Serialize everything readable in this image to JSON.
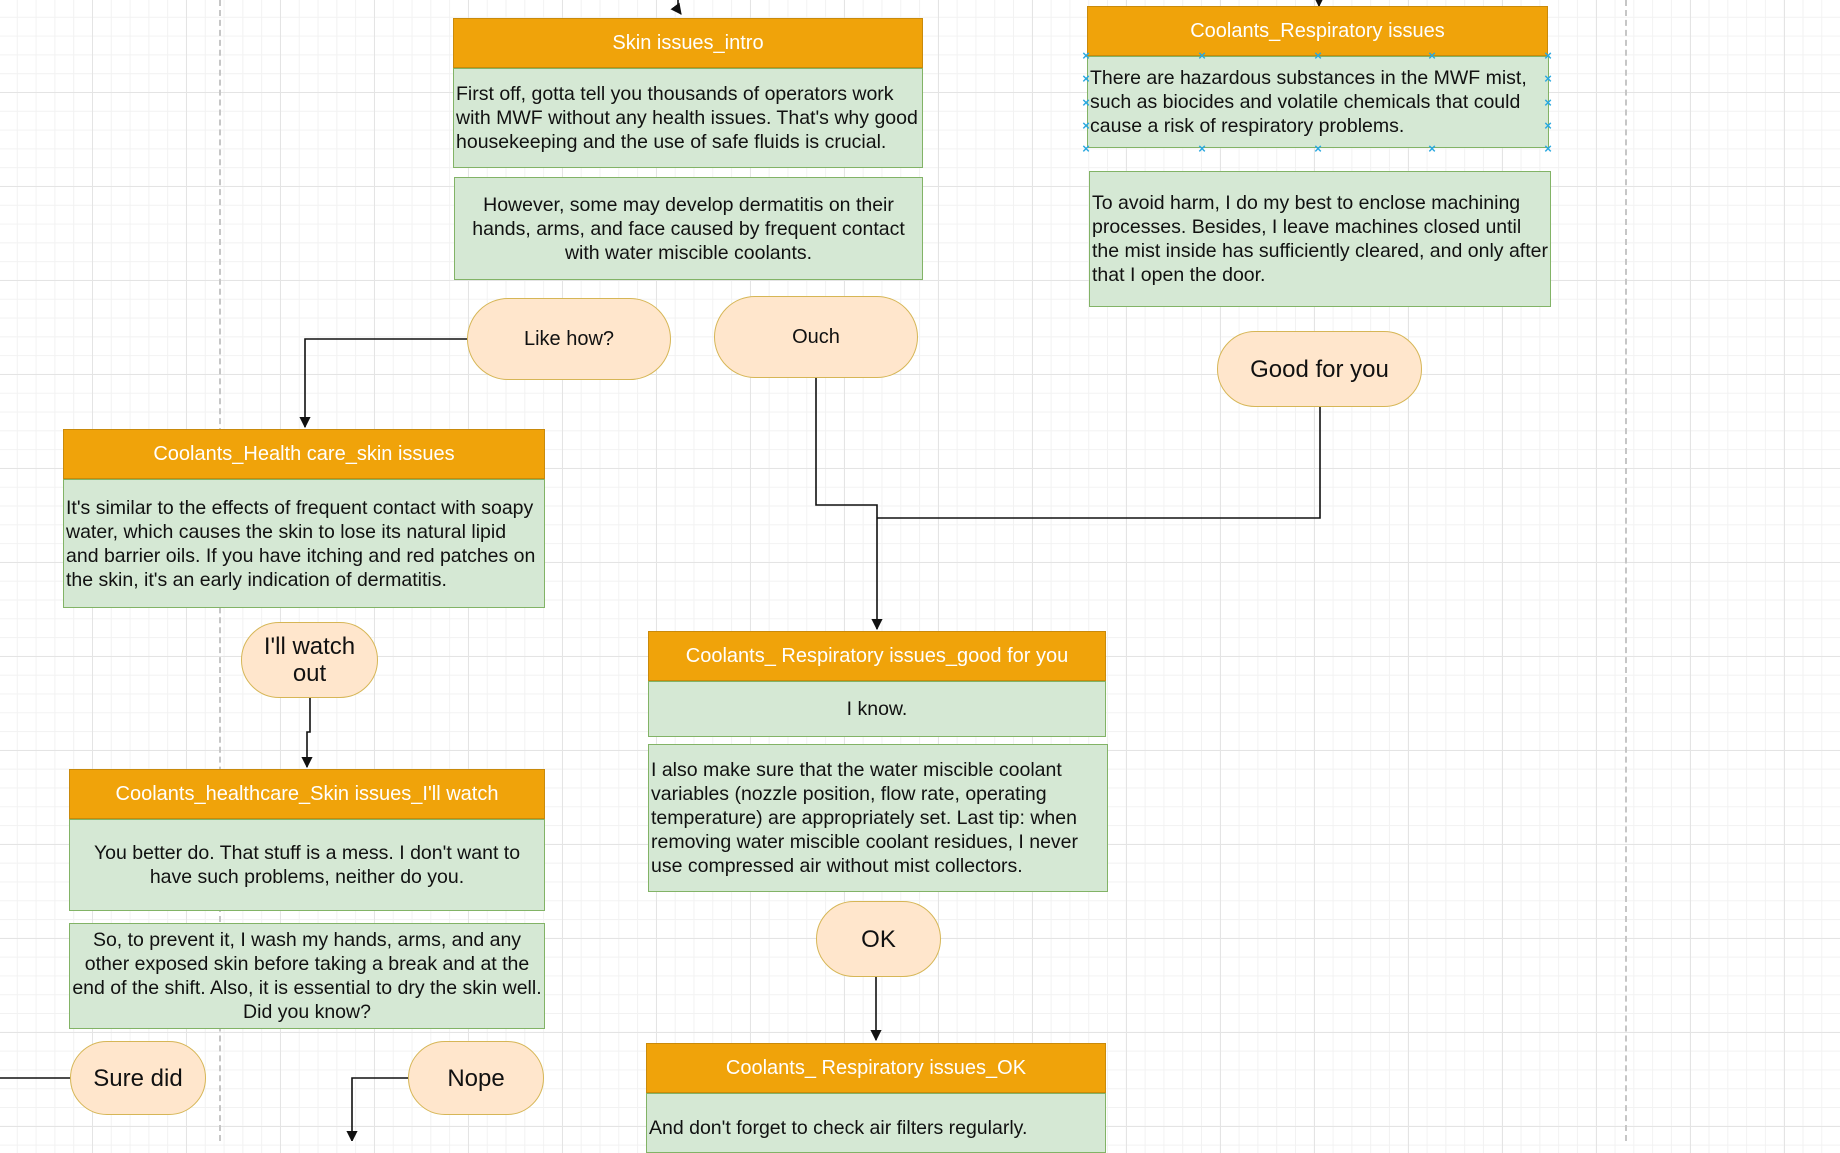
{
  "nodes": {
    "skin_intro": {
      "title": "Skin issues_intro",
      "text1": "First off, gotta tell you thousands of operators work with MWF without any health issues. That's why good housekeeping and the use of safe fluids is crucial.",
      "text2": "However, some may develop dermatitis on their hands, arms, and face caused by frequent contact with water miscible coolants."
    },
    "resp": {
      "title": "Coolants_Respiratory issues",
      "text1": "There are hazardous substances in the MWF mist, such as biocides and volatile chemicals that could cause a risk of respiratory problems.",
      "text2": "To avoid harm, I do my best to enclose machining processes. Besides, I leave machines closed until the mist inside has sufficiently cleared, and only after that I open the door."
    },
    "health_skin": {
      "title": "Coolants_Health care_skin issues",
      "text1": "It's similar to the effects of frequent contact with soapy water, which causes the skin to lose its natural lipid and barrier oils. If you have itching and red patches on the skin, it's an early indication of dermatitis."
    },
    "resp_good": {
      "title": "Coolants_ Respiratory issues_good for you",
      "text1": "I know.",
      "text2": "I also make sure that the water miscible coolant variables (nozzle position, flow rate, operating temperature) are appropriately set. Last tip: when removing water miscible coolant residues, I never use compressed air without mist collectors."
    },
    "watch": {
      "title": "Coolants_healthcare_Skin issues_I'll watch",
      "text1": "You better do. That stuff is a mess. I don't want to have such problems, neither do you.",
      "text2": "So, to prevent it, I wash my hands, arms, and any other exposed skin before taking a break and at the end of the shift. Also, it is essential to dry the skin well. Did you know?"
    },
    "resp_ok": {
      "title": "Coolants_ Respiratory issues_OK",
      "text1": "And don't forget to check air filters regularly."
    }
  },
  "options": {
    "like_how": "Like how?",
    "ouch": "Ouch",
    "good_for_you": "Good for you",
    "watch_out": "I'll watch out",
    "ok": "OK",
    "sure_did": "Sure did",
    "nope": "Nope"
  },
  "colors": {
    "header_fill": "#f0a30a",
    "body_fill": "#d5e8d4",
    "option_fill": "#ffe6cc",
    "selection": "#29a8e0"
  }
}
